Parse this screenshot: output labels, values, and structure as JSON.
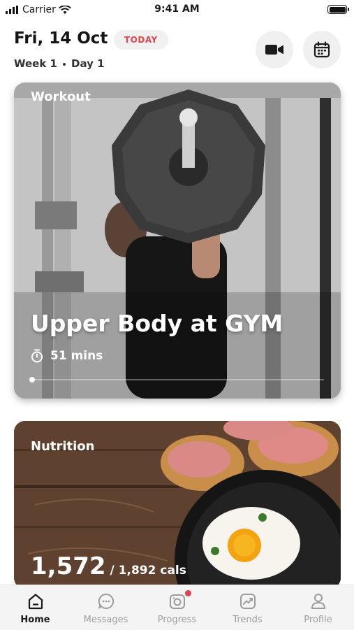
{
  "status": {
    "carrier": "Carrier",
    "time": "9:41 AM"
  },
  "header": {
    "date": "Fri, 14 Oct",
    "today_label": "TODAY",
    "week": "Week 1",
    "day": "Day 1",
    "video_icon": "video-camera-icon",
    "calendar_icon": "calendar-icon"
  },
  "workout": {
    "label": "Workout",
    "title": "Upper Body at GYM",
    "duration": "51 mins",
    "progress": 0
  },
  "nutrition": {
    "label": "Nutrition",
    "consumed": "1,572",
    "goal": "/ 1,892 cals"
  },
  "tabs": [
    {
      "label": "Home",
      "icon": "home-icon",
      "active": true
    },
    {
      "label": "Messages",
      "icon": "chat-icon",
      "active": false
    },
    {
      "label": "Progress",
      "icon": "camera-icon",
      "active": false,
      "badge": true
    },
    {
      "label": "Trends",
      "icon": "trend-chart-icon",
      "active": false
    },
    {
      "label": "Profile",
      "icon": "person-icon",
      "active": false
    }
  ],
  "colors": {
    "accent": "#e0434f",
    "active_tab": "#1b1b1b",
    "inactive_tab": "#9c9c9c"
  }
}
